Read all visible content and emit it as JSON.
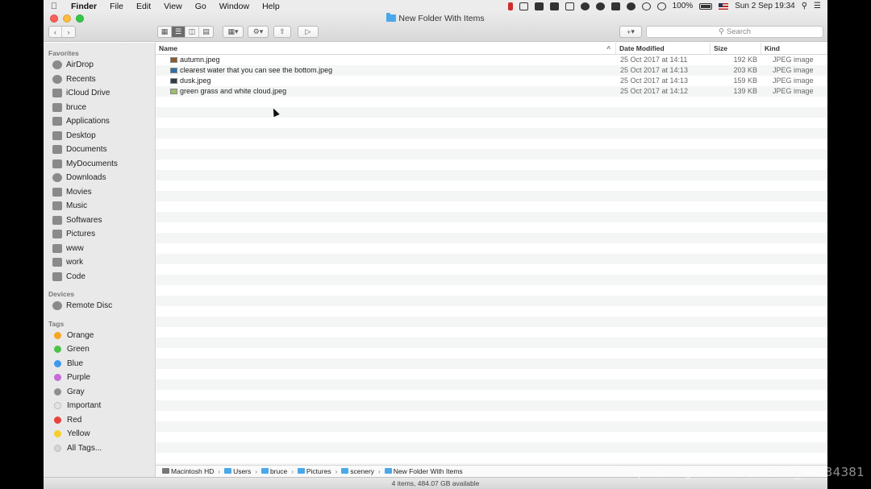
{
  "menubar": {
    "apple": "",
    "items": [
      "Finder",
      "File",
      "Edit",
      "View",
      "Go",
      "Window",
      "Help"
    ],
    "battery": "100%",
    "datetime": "Sun 2 Sep  19:34"
  },
  "window": {
    "title": "New Folder With Items"
  },
  "toolbar": {
    "add_label": "+",
    "search_placeholder": "Search"
  },
  "sidebar": {
    "favorites_header": "Favorites",
    "favorites": [
      {
        "label": "AirDrop",
        "icon": "airdrop-icon"
      },
      {
        "label": "Recents",
        "icon": "recents-icon"
      },
      {
        "label": "iCloud Drive",
        "icon": "cloud-icon"
      },
      {
        "label": "bruce",
        "icon": "home-icon"
      },
      {
        "label": "Applications",
        "icon": "applications-icon"
      },
      {
        "label": "Desktop",
        "icon": "desktop-icon"
      },
      {
        "label": "Documents",
        "icon": "documents-icon"
      },
      {
        "label": "MyDocuments",
        "icon": "folder-icon"
      },
      {
        "label": "Downloads",
        "icon": "downloads-icon"
      },
      {
        "label": "Movies",
        "icon": "movies-icon"
      },
      {
        "label": "Music",
        "icon": "music-icon"
      },
      {
        "label": "Softwares",
        "icon": "folder-icon"
      },
      {
        "label": "Pictures",
        "icon": "pictures-icon"
      },
      {
        "label": "www",
        "icon": "folder-icon"
      },
      {
        "label": "work",
        "icon": "folder-icon"
      },
      {
        "label": "Code",
        "icon": "folder-icon"
      }
    ],
    "devices_header": "Devices",
    "devices": [
      {
        "label": "Remote Disc",
        "icon": "disc-icon"
      }
    ],
    "tags_header": "Tags",
    "tags": [
      {
        "label": "Orange",
        "color": "#f5a623"
      },
      {
        "label": "Green",
        "color": "#4cc24a"
      },
      {
        "label": "Blue",
        "color": "#3d9bf0"
      },
      {
        "label": "Purple",
        "color": "#c86ad8"
      },
      {
        "label": "Gray",
        "color": "#8e8e8e"
      },
      {
        "label": "Important",
        "color": "#e3e3e3"
      },
      {
        "label": "Red",
        "color": "#e8433a"
      },
      {
        "label": "Yellow",
        "color": "#f6cf2b"
      },
      {
        "label": "All Tags...",
        "color": "#d4d4d4"
      }
    ]
  },
  "list": {
    "columns": {
      "name": "Name",
      "date": "Date Modified",
      "size": "Size",
      "kind": "Kind"
    },
    "sort_arrow": "^",
    "files": [
      {
        "name": "autumn.jpeg",
        "date": "25 Oct 2017 at 14:11",
        "size": "192 KB",
        "kind": "JPEG image",
        "thumb_color": "#8a5a2b"
      },
      {
        "name": "clearest water that you can see the bottom.jpeg",
        "date": "25 Oct 2017 at 14:13",
        "size": "203 KB",
        "kind": "JPEG image",
        "thumb_color": "#2f6fa8"
      },
      {
        "name": "dusk.jpeg",
        "date": "25 Oct 2017 at 14:13",
        "size": "159 KB",
        "kind": "JPEG image",
        "thumb_color": "#333b44"
      },
      {
        "name": "green grass and white cloud.jpeg",
        "date": "25 Oct 2017 at 14:12",
        "size": "139 KB",
        "kind": "JPEG image",
        "thumb_color": "#9bbf6a"
      }
    ]
  },
  "pathbar": [
    "Macintosh HD",
    "Users",
    "bruce",
    "Pictures",
    "scenery",
    "New Folder With Items"
  ],
  "statusbar": "4 items, 484.07 GB available",
  "watermark": "https://blog.csdn.net/weixin_44334381"
}
